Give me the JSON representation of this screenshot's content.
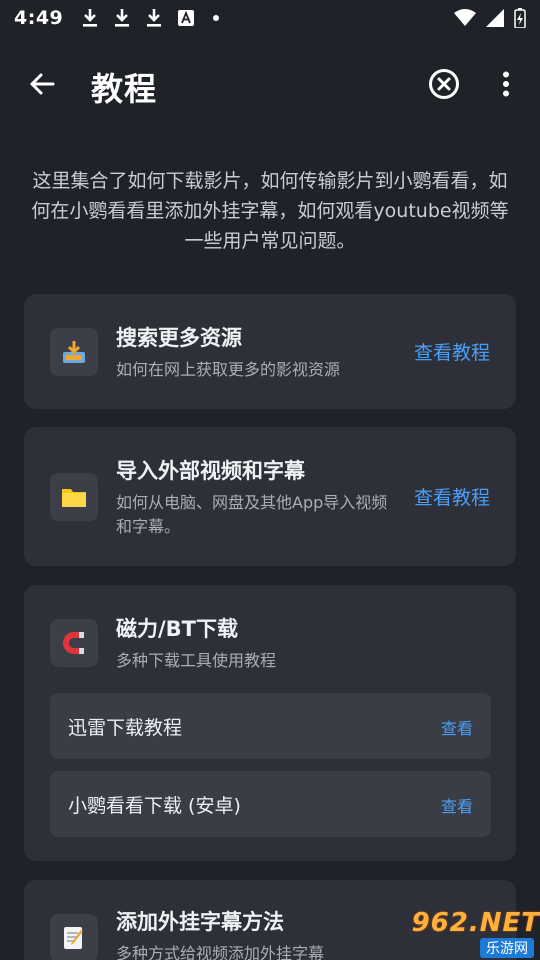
{
  "status_bar": {
    "time": "4:49",
    "left_icons": [
      "download-icon",
      "download-icon",
      "download-icon",
      "font-a-icon",
      "dot-icon"
    ],
    "right_icons": [
      "wifi-icon",
      "signal-icon",
      "battery-icon"
    ]
  },
  "app_bar": {
    "title": "教程",
    "icons": [
      "back-arrow-icon",
      "close-circle-icon",
      "more-vert-icon"
    ]
  },
  "intro": "这里集合了如何下载影片，如何传输影片到小鹦看看，如何在小鹦看看里添加外挂字幕，如何观看youtube视频等一些用户常见问题。",
  "cards": [
    {
      "icon": "download-tray-icon",
      "title": "搜索更多资源",
      "desc": "如何在网上获取更多的影视资源",
      "link": "查看教程"
    },
    {
      "icon": "folder-icon",
      "title": "导入外部视频和字幕",
      "desc": "如何从电脑、网盘及其他App导入视频和字幕。",
      "link": "查看教程"
    },
    {
      "icon": "magnet-icon",
      "title": "磁力/BT下载",
      "desc": "多种下载工具使用教程",
      "items": [
        {
          "label": "迅雷下载教程",
          "link": "查看"
        },
        {
          "label": "小鹦看看下载 (安卓)",
          "link": "查看"
        }
      ]
    },
    {
      "icon": "memo-icon",
      "title": "添加外挂字幕方法",
      "desc": "多种方式给视频添加外挂字幕"
    }
  ],
  "watermark": {
    "top": "962.NET",
    "bottom": "乐游网"
  },
  "colors": {
    "background": "#1f2229",
    "card": "#2d3039",
    "link": "#4a9ef5"
  }
}
